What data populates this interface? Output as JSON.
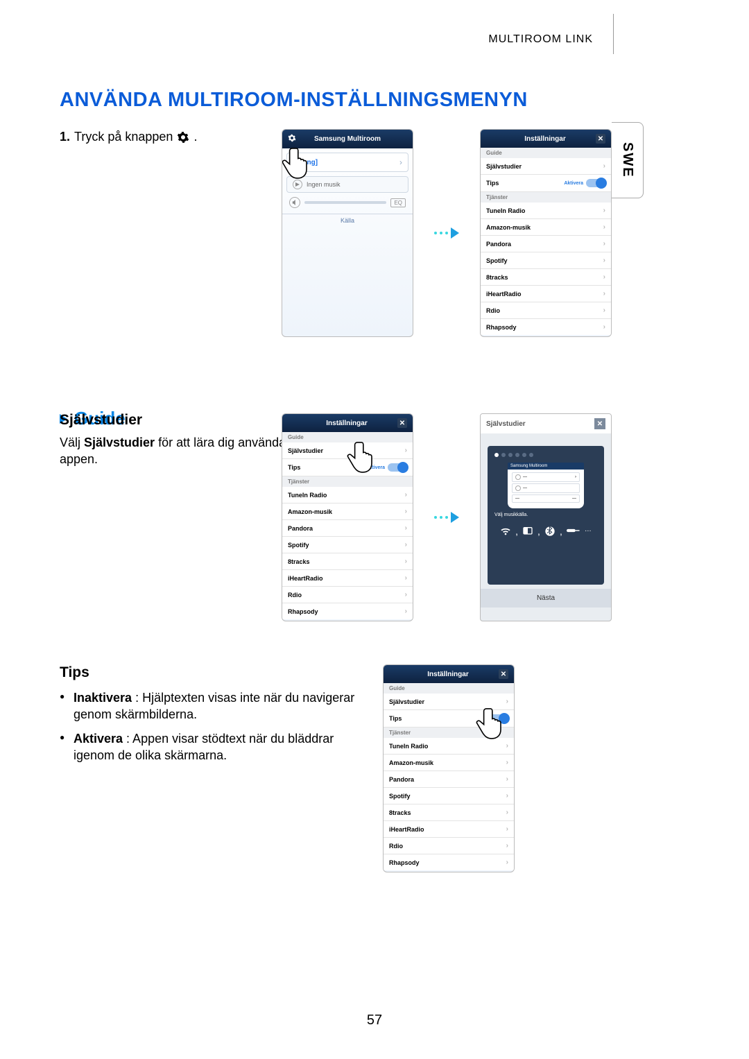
{
  "header": "MULTIROOM LINK",
  "sideTab": "SWE",
  "title": "ANVÄNDA MULTIROOM-INSTÄLLNINGSMENYN",
  "step1_prefix": "1.",
  "step1_text": "Tryck på knappen",
  "step1_suffix": ".",
  "phone1": {
    "header": "Samsung Multiroom",
    "card_label": "msung]",
    "no_music": "Ingen musik",
    "eq": "EQ",
    "source": "Källa"
  },
  "settings": {
    "title": "Inställningar",
    "guide_sect": "Guide",
    "sjalv": "Självstudier",
    "tips": "Tips",
    "aktivera_label": "Aktivera",
    "services_sect": "Tjänster",
    "services": [
      "TuneIn Radio",
      "Amazon-musik",
      "Pandora",
      "Spotify",
      "8tracks",
      "iHeartRadio",
      "Rdio",
      "Rhapsody"
    ]
  },
  "guide_heading": "Guide",
  "sjalv_heading": "Självstudier",
  "sjalv_body_prefix": "Välj ",
  "sjalv_body_bold": "Självstudier",
  "sjalv_body_suffix": " för att lära dig använda appen.",
  "tutorial": {
    "header": "Självstudier",
    "mini_title": "Samsung Multiroom",
    "caption": "Välj musikkälla.",
    "next": "Nästa"
  },
  "tips_heading": "Tips",
  "tips_b1_bold": "Inaktivera",
  "tips_b1_text": " : Hjälptexten visas inte när du navigerar genom skärmbilderna.",
  "tips_b2_bold": "Aktivera",
  "tips_b2_text": " : Appen visar stödtext när du bläddrar igenom de olika skärmarna.",
  "page": "57"
}
